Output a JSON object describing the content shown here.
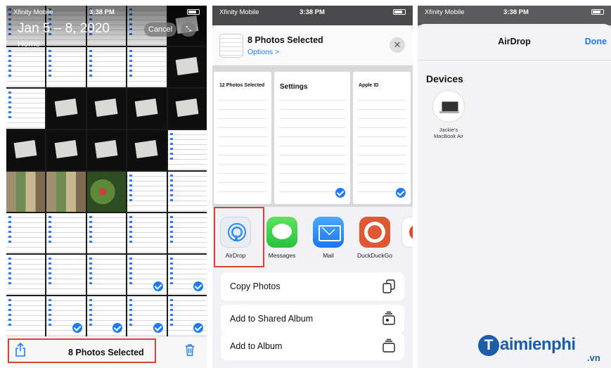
{
  "status_bar": {
    "carrier": "Xfinity Mobile",
    "time": "3:38 PM"
  },
  "photos": {
    "date_range": "Jan 5 – 8, 2020",
    "back_label": "Home",
    "cancel_label": "Cancel",
    "zoom_label": "⤡",
    "selected_count_label": "8 Photos Selected",
    "grid": [
      "ss",
      "ss",
      "ss",
      "ss",
      "photo",
      "ss",
      "ss",
      "ss",
      "ss",
      "photo",
      "ss",
      "photo",
      "photo",
      "photo",
      "photo",
      "photo",
      "photo",
      "photo",
      "photo",
      "ss",
      "mosaic",
      "mosaic",
      "flower",
      "ss",
      "ss",
      "ss",
      "ss",
      "ss",
      "ss",
      "ss",
      "ss",
      "ss",
      "ss",
      "ss",
      "ss",
      "ss",
      "ss",
      "ss",
      "ss",
      "ss"
    ],
    "checked_cells": [
      33,
      34,
      36,
      37,
      38,
      39
    ]
  },
  "share_sheet": {
    "title": "8 Photos Selected",
    "options_label": "Options >",
    "close_label": "✕",
    "preview_titles": [
      "12 Photos Selected",
      "Settings",
      "Apple ID"
    ],
    "apps": [
      {
        "label": "AirDrop",
        "icon": "airdrop-icon"
      },
      {
        "label": "Messages",
        "icon": "messages-icon"
      },
      {
        "label": "Mail",
        "icon": "mail-icon"
      },
      {
        "label": "DuckDuckGo",
        "icon": "duckduckgo-icon"
      },
      {
        "label": "",
        "icon": "more-app-icon"
      }
    ],
    "actions": [
      {
        "label": "Copy Photos",
        "icon": "copy-icon"
      },
      {
        "label": "Add to Shared Album",
        "icon": "shared-album-icon"
      },
      {
        "label": "Add to Album",
        "icon": "album-icon"
      }
    ]
  },
  "airdrop": {
    "title": "AirDrop",
    "done_label": "Done",
    "section_label": "Devices",
    "device_name_line1": "Jackie's",
    "device_name_line2": "MacBook Air"
  },
  "watermark": {
    "brand": "aimienphi",
    "brand_initial": "T",
    "tld": ".vn"
  },
  "colors": {
    "accent": "#1e7cf2",
    "highlight_box": "#d9432f",
    "brand": "#1c5da8"
  }
}
